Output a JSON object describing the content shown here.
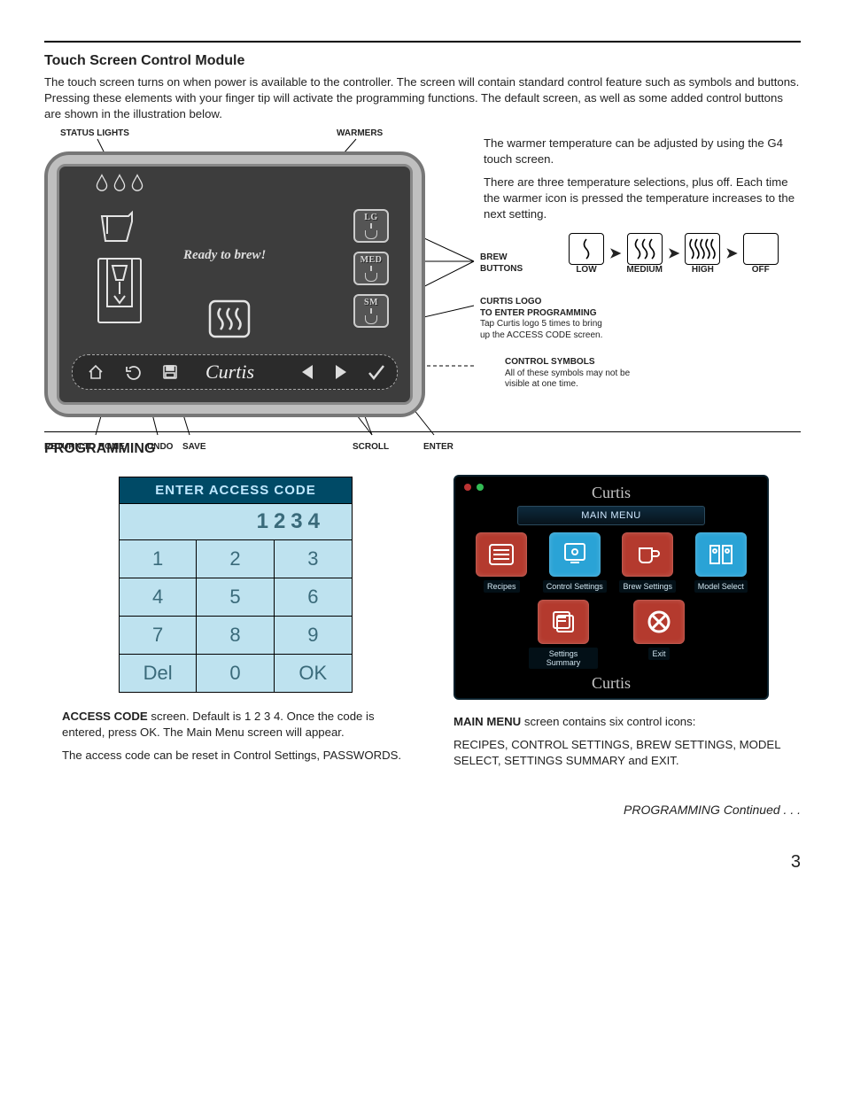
{
  "page_number": "3",
  "section1": {
    "title": "Touch Screen Control Module",
    "body": "The touch screen turns on when power is available to the controller. The screen will contain standard control feature such as symbols and buttons. Pressing these elements with your finger tip will activate the programming functions. The default screen, as well as some added control buttons are shown in the illustration below."
  },
  "figure": {
    "labels": {
      "status": "STATUS LIGHTS",
      "warmers": "WARMERS",
      "brew_buttons": "BREW\nBUTTONS",
      "curtis_logo": "CURTIS LOGO\nTO ENTER PROGRAMMING",
      "curtis_logo_sub": "Tap Curtis logo 5 times to bring\nup the ACCESS CODE screen.",
      "control_symbols": "CONTROL SYMBOLS",
      "control_symbols_sub": "All of these symbols may not be\nvisible at one time.",
      "return_home": "RETURN TO HOME",
      "undo": "UNDO",
      "save": "SAVE",
      "scroll": "SCROLL",
      "enter": "ENTER"
    },
    "screen": {
      "ready": "Ready to brew!",
      "sizes": {
        "lg": "LG",
        "med": "MED",
        "sm": "SM"
      },
      "curtis": "Curtis"
    }
  },
  "warmer_text": {
    "p1": "The warmer temperature can be adjusted by using the G4 touch screen.",
    "p2": "There are three temperature selections, plus off. Each time the warmer icon is pressed the temperature increases to the next setting.",
    "levels": {
      "low": "LOW",
      "medium": "MEDIUM",
      "high": "HIGH",
      "off": "OFF"
    }
  },
  "programming": {
    "heading": "PROGRAMMING",
    "access_code": {
      "title": "ENTER ACCESS CODE",
      "display": "1234",
      "keys": [
        "1",
        "2",
        "3",
        "4",
        "5",
        "6",
        "7",
        "8",
        "9",
        "Del",
        "0",
        "OK"
      ],
      "text1_b": "ACCESS CODE",
      "text1": " screen. Default is 1 2 3 4. Once the code is entered, press OK. The Main Menu screen will appear.",
      "text2": "The access code can be reset in Control Settings, PASSWORDS."
    },
    "main_menu": {
      "logo": "Curtis",
      "title": "MAIN MENU",
      "tiles": [
        {
          "label": "Recipes",
          "color": "#b43a2e"
        },
        {
          "label": "Control Settings",
          "color": "#2aa3d6"
        },
        {
          "label": "Brew Settings",
          "color": "#b43a2e"
        },
        {
          "label": "Model Select",
          "color": "#2aa3d6"
        },
        {
          "label": "Settings Summary",
          "color": "#b43a2e"
        },
        {
          "label": "Exit",
          "color": "#b43a2e"
        }
      ],
      "text1_b": "MAIN MENU",
      "text1": " screen contains six control icons:",
      "text2": "RECIPES, CONTROL SETTINGS, BREW SETTINGS, MODEL SELECT, SETTINGS SUMMARY and EXIT."
    },
    "continued": "PROGRAMMING Continued . . ."
  }
}
